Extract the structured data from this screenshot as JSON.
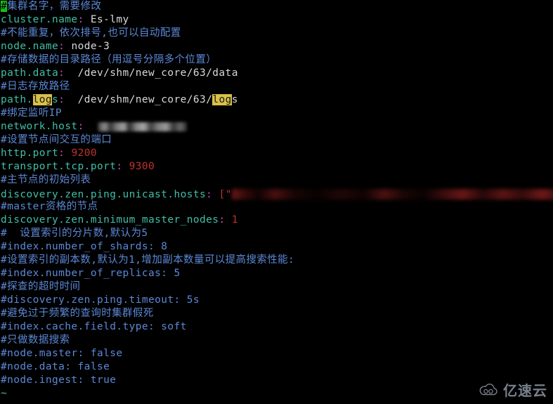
{
  "window": {
    "kind": "terminal-text-editor",
    "editor": "vim",
    "filename": "elasticsearch.yml",
    "background_color": "#000000"
  },
  "colors": {
    "comment": "#5c88d6",
    "key": "#3fbfa8",
    "colon": "#c050c0",
    "value": "#d8d8d8",
    "number": "#c03030",
    "search_highlight_bg": "#d9c04a",
    "cursor_bg": "#17c017"
  },
  "search": {
    "term": "log"
  },
  "lines": [
    {
      "id": 1,
      "type": "comment",
      "cursor_char": "#",
      "text": "集群名字，需要修改",
      "full": "#集群名字，需要修改"
    },
    {
      "id": 2,
      "type": "setting",
      "key": "cluster.name",
      "colon": ":",
      "value": "Es-lmy",
      "value_kind": "text"
    },
    {
      "id": 3,
      "type": "comment",
      "text": "#不能重复，依次排号,也可以自动配置"
    },
    {
      "id": 4,
      "type": "setting",
      "key": "node.name",
      "colon": ":",
      "value": "node-3",
      "value_kind": "text"
    },
    {
      "id": 5,
      "type": "comment",
      "text": "#存储数据的目录路径（用逗号分隔多个位置）"
    },
    {
      "id": 6,
      "type": "setting",
      "key": "path.data",
      "colon": ":",
      "value": "/dev/shm/new_core/63/data",
      "value_kind": "text"
    },
    {
      "id": 7,
      "type": "comment",
      "text": "#日志存放路径"
    },
    {
      "id": 8,
      "type": "setting-highlighted",
      "key_prefix": "path.",
      "key_highlight": "log",
      "key_suffix": "s",
      "colon": ":",
      "value_prefix": "/dev/shm/new_core/63/",
      "value_highlight": "log",
      "value_suffix": "s",
      "full": "path.logs: /dev/shm/new_core/63/logs"
    },
    {
      "id": 9,
      "type": "comment",
      "text": "#绑定监听IP"
    },
    {
      "id": 10,
      "type": "setting-redacted",
      "key": "network.host",
      "colon": ":",
      "value": "",
      "redacted": true,
      "redaction_note": "IP address blurred"
    },
    {
      "id": 11,
      "type": "comment",
      "text": "#设置节点间交互的端口"
    },
    {
      "id": 12,
      "type": "setting",
      "key": "http.port",
      "colon": ":",
      "value": "9200",
      "value_kind": "number"
    },
    {
      "id": 13,
      "type": "setting",
      "key": "transport.tcp.port",
      "colon": ":",
      "value": "9300",
      "value_kind": "number"
    },
    {
      "id": 14,
      "type": "comment",
      "text": "#主节点的初始列表"
    },
    {
      "id": 15,
      "type": "setting-redacted-list",
      "key": "discovery.zen.ping.unicast.hosts",
      "colon": ":",
      "open": "[\"",
      "close": "\"]",
      "redacted": true,
      "redaction_note": "host IP list blurred"
    },
    {
      "id": 16,
      "type": "comment",
      "text": "#master资格的节点"
    },
    {
      "id": 17,
      "type": "setting",
      "key": "discovery.zen.minimum_master_nodes",
      "colon": ":",
      "value": "1",
      "value_kind": "number"
    },
    {
      "id": 18,
      "type": "comment",
      "text": "#  设置索引的分片数,默认为5"
    },
    {
      "id": 19,
      "type": "comment",
      "text": "#index.number_of_shards: 8"
    },
    {
      "id": 20,
      "type": "comment",
      "text": "#设置索引的副本数,默认为1,增加副本数量可以提高搜索性能:"
    },
    {
      "id": 21,
      "type": "comment",
      "text": "#index.number_of_replicas: 5"
    },
    {
      "id": 22,
      "type": "comment",
      "text": "#探查的超时时间"
    },
    {
      "id": 23,
      "type": "comment",
      "text": "#discovery.zen.ping.timeout: 5s"
    },
    {
      "id": 24,
      "type": "comment",
      "text": "#避免过于频繁的查询时集群假死"
    },
    {
      "id": 25,
      "type": "comment",
      "text": "#index.cache.field.type: soft"
    },
    {
      "id": 26,
      "type": "comment",
      "text": "#只做数据搜索"
    },
    {
      "id": 27,
      "type": "comment",
      "text": "#node.master: false"
    },
    {
      "id": 28,
      "type": "comment",
      "text": "#node.data: false"
    },
    {
      "id": 29,
      "type": "comment",
      "text": "#node.ingest: true"
    },
    {
      "id": 30,
      "type": "empty-marker",
      "text": "~"
    }
  ],
  "watermark": {
    "text": "亿速云",
    "icon": "cloud-icon"
  }
}
